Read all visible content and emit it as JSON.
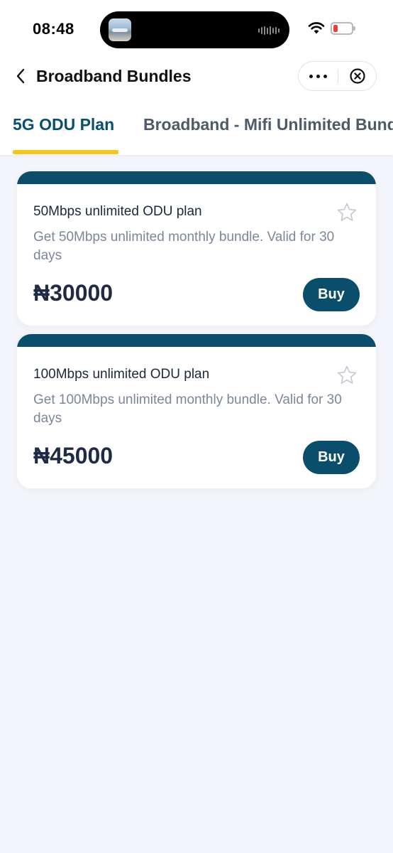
{
  "status_bar": {
    "time": "08:48",
    "wifi_icon": "wifi-icon",
    "battery_icon": "battery-low-icon",
    "battery_level_fraction": 0.15
  },
  "header": {
    "title": "Broadband Bundles",
    "back_icon": "chevron-left-icon",
    "more_icon": "more-horizontal-icon",
    "close_icon": "circle-close-icon"
  },
  "tabs": [
    {
      "label": "5G ODU Plan",
      "active": true
    },
    {
      "label": "Broadband - Mifi Unlimited Bundles",
      "active": false
    }
  ],
  "plans": [
    {
      "title": "50Mbps unlimited ODU plan",
      "description": "Get 50Mbps unlimited monthly bundle. Valid for 30 days",
      "price": "₦30000",
      "buy_label": "Buy",
      "favorite_icon": "star-outline-icon"
    },
    {
      "title": "100Mbps unlimited ODU plan",
      "description": "Get 100Mbps unlimited monthly bundle. Valid for 30 days",
      "price": "₦45000",
      "buy_label": "Buy",
      "favorite_icon": "star-outline-icon"
    }
  ],
  "colors": {
    "accent": "#0a4e6b",
    "tab_indicator": "#f5c61b",
    "background": "#f4f5fa",
    "price_text": "#1f2b45"
  }
}
